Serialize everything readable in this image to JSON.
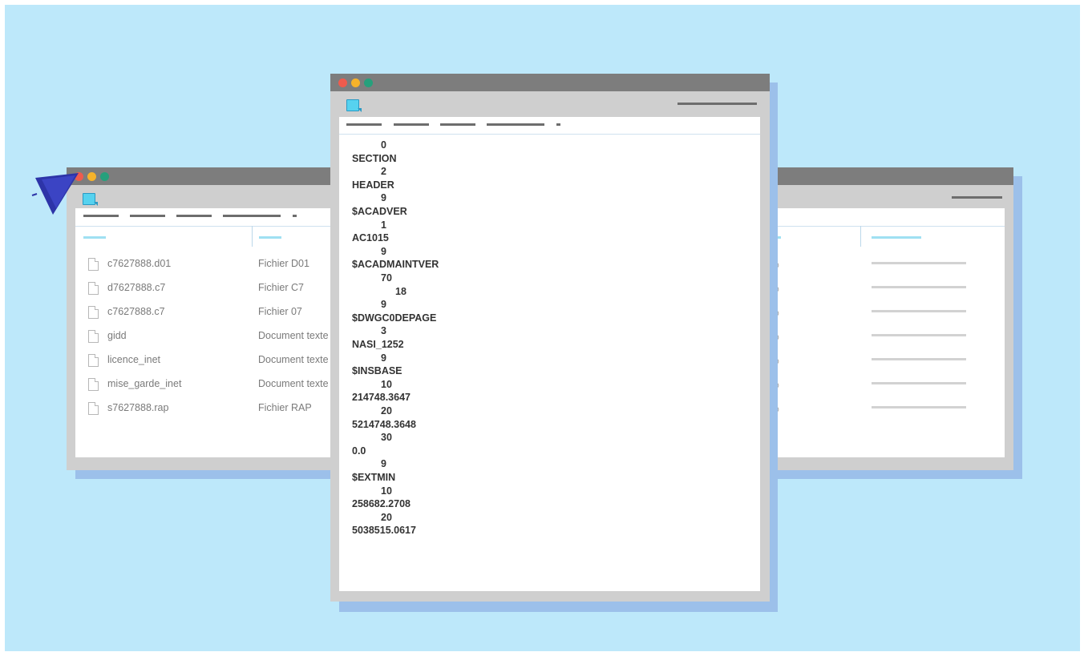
{
  "colors": {
    "background": "#bde8fa",
    "window_frame": "#cfcfcf",
    "titlebar": "#7d7d7d",
    "shadow": "#9cc0ea",
    "accent": "#56d2ef",
    "cursor": "#2d34a8"
  },
  "file_list": {
    "rows": [
      {
        "name": "c7627888.d01",
        "type": "Fichier D01",
        "pct": "%"
      },
      {
        "name": "d7627888.c7",
        "type": "Fichier C7",
        "pct": "%"
      },
      {
        "name": "c7627888.c7",
        "type": "Fichier 07",
        "pct": "%"
      },
      {
        "name": "gidd",
        "type": "Document texte",
        "pct": "%"
      },
      {
        "name": "licence_inet",
        "type": "Document texte",
        "pct": "%"
      },
      {
        "name": "mise_garde_inet",
        "type": "Document texte",
        "pct": "%"
      },
      {
        "name": "s7627888.rap",
        "type": "Fichier RAP",
        "pct": "%"
      }
    ]
  },
  "editor": {
    "lines": [
      {
        "text": "0",
        "indent": 2
      },
      {
        "text": "SECTION",
        "indent": 0
      },
      {
        "text": "2",
        "indent": 2
      },
      {
        "text": "HEADER",
        "indent": 0
      },
      {
        "text": "9",
        "indent": 2
      },
      {
        "text": "$ACADVER",
        "indent": 0
      },
      {
        "text": "1",
        "indent": 2
      },
      {
        "text": "AC1015",
        "indent": 0
      },
      {
        "text": "9",
        "indent": 2
      },
      {
        "text": "$ACADMAINTVER",
        "indent": 0
      },
      {
        "text": "70",
        "indent": 2
      },
      {
        "text": "18",
        "indent": 3
      },
      {
        "text": "9",
        "indent": 2
      },
      {
        "text": "$DWGC0DEPAGE",
        "indent": 0
      },
      {
        "text": "3",
        "indent": 2
      },
      {
        "text": "NASI_1252",
        "indent": 0
      },
      {
        "text": "9",
        "indent": 2
      },
      {
        "text": "$INSBASE",
        "indent": 0
      },
      {
        "text": "10",
        "indent": 2
      },
      {
        "text": "214748.3647",
        "indent": 0
      },
      {
        "text": "20",
        "indent": 2
      },
      {
        "text": "5214748.3648",
        "indent": 0
      },
      {
        "text": "30",
        "indent": 2
      },
      {
        "text": "0.0",
        "indent": 0
      },
      {
        "text": "9",
        "indent": 2
      },
      {
        "text": "$EXTMIN",
        "indent": 0
      },
      {
        "text": "10",
        "indent": 2
      },
      {
        "text": "258682.2708",
        "indent": 0
      },
      {
        "text": "20",
        "indent": 2
      },
      {
        "text": "5038515.0617",
        "indent": 0
      }
    ]
  }
}
